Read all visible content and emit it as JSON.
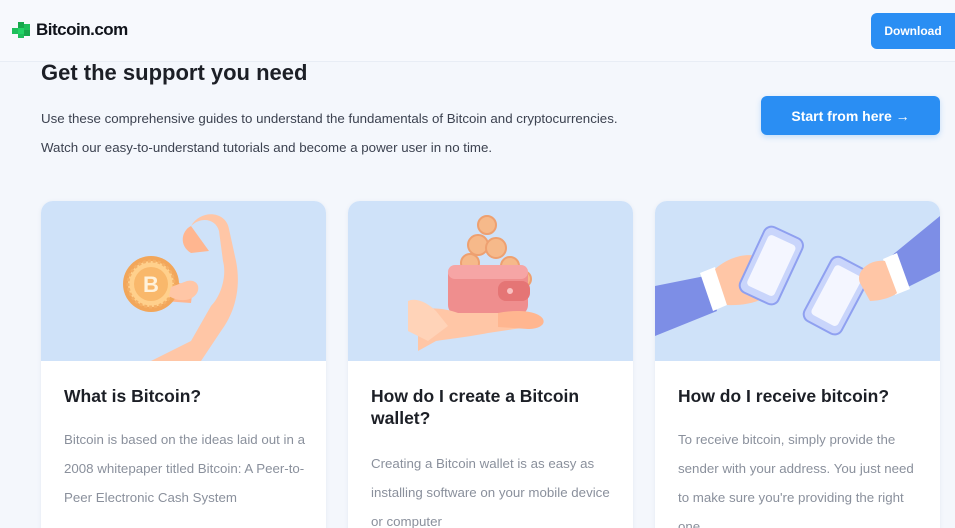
{
  "header": {
    "logo_text": "Bitcoin.com",
    "download_label": "Download",
    "colors": {
      "accent": "#2a8ef3",
      "logo_green": "#1fbf5b"
    }
  },
  "hero": {
    "title": "Get the support you need",
    "intro_line1": "Use these comprehensive guides to understand the fundamentals of Bitcoin and cryptocurrencies.",
    "intro_line2": "Watch our easy-to-understand tutorials and become a power user in no time.",
    "cta_label": "Start from here →"
  },
  "cards": [
    {
      "icon": "bitcoin-coin-hand-icon",
      "title": "What is Bitcoin?",
      "text": "Bitcoin is based on the ideas laid out in a 2008 whitepaper titled Bitcoin: A Peer-to-Peer Electronic Cash System"
    },
    {
      "icon": "wallet-coins-hand-icon",
      "title": "How do I create a Bitcoin wallet?",
      "text": "Creating a Bitcoin wallet is as easy as installing software on your mobile device or computer"
    },
    {
      "icon": "phones-exchange-icon",
      "title": "How do I receive bitcoin?",
      "text": "To receive bitcoin, simply provide the sender with your address. You just need to make sure you're providing the right one"
    }
  ]
}
